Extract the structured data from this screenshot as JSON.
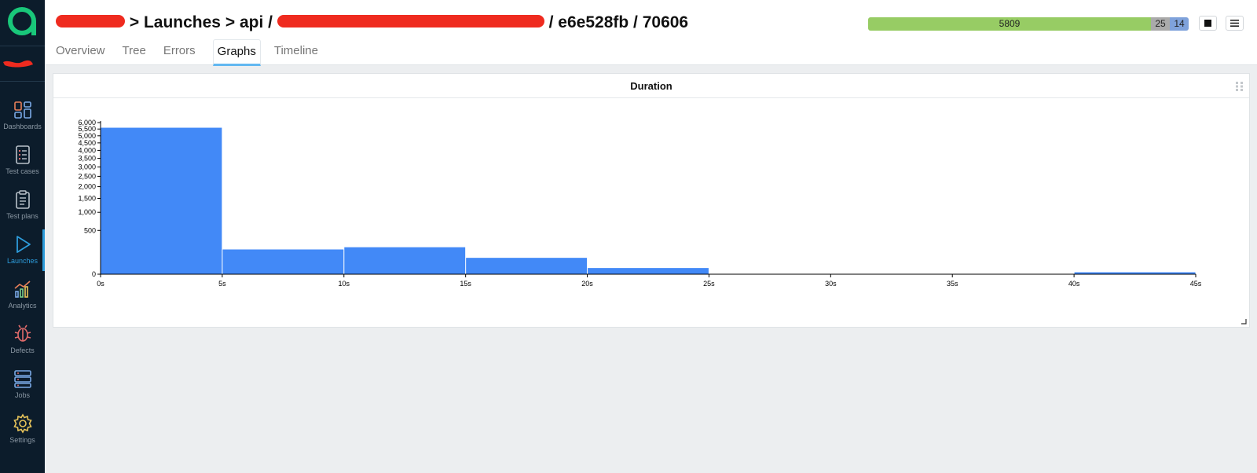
{
  "sidebar": {
    "items": [
      {
        "label": "Dashboards",
        "icon": "dashboards-icon",
        "active": false
      },
      {
        "label": "Test cases",
        "icon": "test-cases-icon",
        "active": false
      },
      {
        "label": "Test plans",
        "icon": "test-plans-icon",
        "active": false
      },
      {
        "label": "Launches",
        "icon": "launches-icon",
        "active": true
      },
      {
        "label": "Analytics",
        "icon": "analytics-icon",
        "active": false
      },
      {
        "label": "Defects",
        "icon": "defects-icon",
        "active": false
      },
      {
        "label": "Jobs",
        "icon": "jobs-icon",
        "active": false
      },
      {
        "label": "Settings",
        "icon": "settings-icon",
        "active": false
      }
    ]
  },
  "header": {
    "sep": ">",
    "launches": "Launches",
    "api": "api /",
    "tail": "/ e6e528fb / 70606",
    "tabs": [
      "Overview",
      "Tree",
      "Errors",
      "Graphs",
      "Timeline"
    ],
    "active_tab": "Graphs"
  },
  "stats": {
    "passed": "5809",
    "broken": "25",
    "skipped": "14"
  },
  "colors": {
    "passed": "#97cc64",
    "broken": "#aaaaaa",
    "skipped": "#7fa2db",
    "bar": "#4289f7",
    "accent": "#2d9cdb",
    "logo": "#19c77a"
  },
  "widget": {
    "title": "Duration"
  },
  "chart_data": {
    "type": "bar",
    "title": "Duration",
    "xlabel": "",
    "ylabel": "",
    "yscale": "sqrt",
    "ylim": [
      0,
      6000
    ],
    "yticks": [
      "0",
      "500",
      "1,000",
      "1,500",
      "2,000",
      "2,500",
      "3,000",
      "3,500",
      "4,000",
      "4,500",
      "5,000",
      "5,500",
      "6,000"
    ],
    "xticks": [
      "0s",
      "5s",
      "10s",
      "15s",
      "20s",
      "25s",
      "30s",
      "35s",
      "40s",
      "45s"
    ],
    "bins": [
      {
        "range": "0s-5s",
        "value": 5600
      },
      {
        "range": "5s-10s",
        "value": 160
      },
      {
        "range": "10s-15s",
        "value": 190
      },
      {
        "range": "15s-20s",
        "value": 70
      },
      {
        "range": "20s-25s",
        "value": 10
      },
      {
        "range": "25s-30s",
        "value": 0
      },
      {
        "range": "30s-35s",
        "value": 0
      },
      {
        "range": "35s-40s",
        "value": 0
      },
      {
        "range": "40s-45s",
        "value": 1
      }
    ]
  }
}
